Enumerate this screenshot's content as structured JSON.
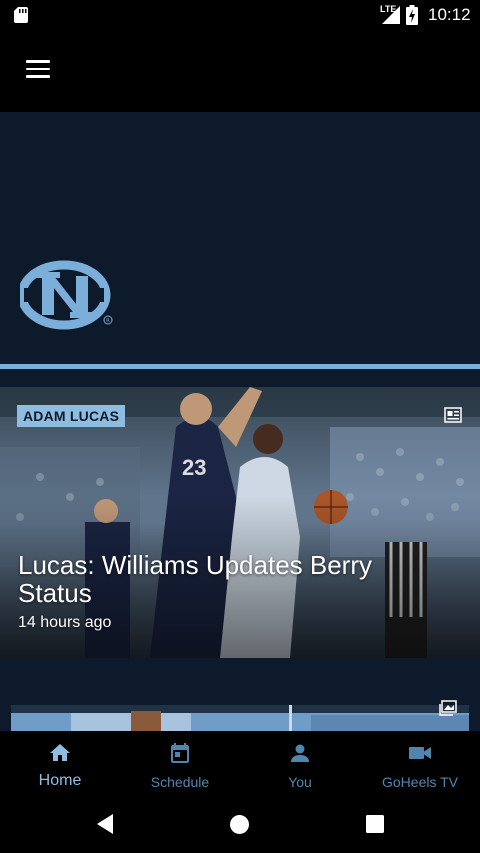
{
  "status_bar": {
    "network": "LTE",
    "time": "10:12"
  },
  "app_bar": {
    "menu_icon": "hamburger-menu-icon"
  },
  "hero": {
    "logo": "unc-nc-logo"
  },
  "feed": {
    "featured_story": {
      "author_tag": "ADAM LUCAS",
      "headline": "Lucas: Williams Updates Berry Status",
      "time_ago": "14 hours ago",
      "type_icon": "article-icon"
    },
    "next_story": {
      "type_icon": "gallery-icon"
    }
  },
  "bottom_nav": {
    "items": [
      {
        "label": "Home",
        "icon": "home-icon",
        "active": true
      },
      {
        "label": "Schedule",
        "icon": "calendar-icon",
        "active": false
      },
      {
        "label": "You",
        "icon": "person-icon",
        "active": false
      },
      {
        "label": "GoHeels TV",
        "icon": "video-camera-icon",
        "active": false
      }
    ]
  },
  "colors": {
    "accent": "#8fbde2",
    "nav_inactive": "#4f86b0",
    "background": "#0d1a2b"
  }
}
